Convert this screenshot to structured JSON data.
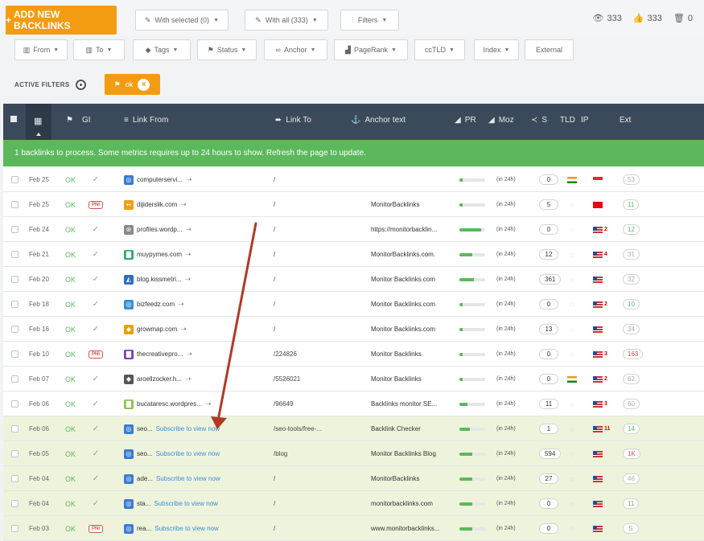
{
  "toolbar": {
    "add_label": "ADD NEW BACKLINKS",
    "with_selected": "With selected (0)",
    "with_all": "With all (333)",
    "filters": "Filters",
    "views": "333",
    "likes": "333",
    "trash": "0"
  },
  "filters": [
    "From",
    "To",
    "Tags",
    "Status",
    "Anchor",
    "PageRank",
    "ccTLD",
    "Index",
    "External"
  ],
  "active_filters": {
    "label": "ACTIVE FILTERS",
    "chip": "ok"
  },
  "columns": {
    "gi": "GI",
    "link_from": "Link From",
    "link_to": "Link To",
    "anchor_text": "Anchor text",
    "pr": "PR",
    "moz": "Moz",
    "s": "S",
    "tld": "TLD",
    "ip": "IP",
    "ext": "Ext"
  },
  "banner": "1 backlinks to process. Some metrics requires up to 24 hours to show. Refresh the page to update.",
  "rows": [
    {
      "date": "Feb 25",
      "status": "OK",
      "from": "computerservi...",
      "link_to": "/",
      "anchor": "",
      "pr": 0.12,
      "moz": "(in 24h)",
      "s": "0",
      "tld": "in",
      "ip_flag": "sg",
      "ip_n": "",
      "ext": "53",
      "ext_c": "grey"
    },
    {
      "date": "Feb 25",
      "status": "OK",
      "gi": "PNI",
      "from": "dijiderslik.com",
      "link_to": "/",
      "anchor": "MonitorBacklinks",
      "pr": 0.12,
      "moz": "(in 24h)",
      "s": "5",
      "tld": "globe",
      "ip_flag": "tr",
      "ip_n": "",
      "ext": "11",
      "ext_c": "green"
    },
    {
      "date": "Feb 24",
      "status": "OK",
      "from": "profiles.wordp...",
      "link_to": "/",
      "anchor": "https://monitorbacklin...",
      "pr": 0.85,
      "moz": "(in 24h)",
      "s": "0",
      "tld": "globe",
      "ip_flag": "us",
      "ip_n": "2",
      "ext": "12",
      "ext_c": "green"
    },
    {
      "date": "Feb 21",
      "status": "OK",
      "from": "muypymes.com",
      "link_to": "/",
      "anchor": "MonitorBacklinks.com.",
      "pr": 0.5,
      "moz": "(in 24h)",
      "s": "12",
      "tld": "globe",
      "ip_flag": "us",
      "ip_n": "4",
      "ext": "31",
      "ext_c": "grey"
    },
    {
      "date": "Feb 20",
      "status": "OK",
      "from": "blog.kissmetri...",
      "link_to": "/",
      "anchor": "Monitor Backlinks.com",
      "pr": 0.55,
      "moz": "(in 24h)",
      "s": "361",
      "tld": "globe",
      "ip_flag": "us",
      "ip_n": "",
      "ext": "32",
      "ext_c": "grey"
    },
    {
      "date": "Feb 18",
      "status": "OK",
      "from": "bizfeedz.com",
      "link_to": "/",
      "anchor": "Monitor Backlinks.com",
      "pr": 0.12,
      "moz": "(in 24h)",
      "s": "0",
      "tld": "globe",
      "ip_flag": "us",
      "ip_n": "2",
      "ext": "10",
      "ext_c": "green"
    },
    {
      "date": "Feb 16",
      "status": "OK",
      "from": "growmap.com",
      "link_to": "/",
      "anchor": "Monitor Backlinks.com",
      "pr": 0.12,
      "moz": "(in 24h)",
      "s": "13",
      "tld": "globe",
      "ip_flag": "us",
      "ip_n": "",
      "ext": "34",
      "ext_c": "grey"
    },
    {
      "date": "Feb 10",
      "status": "OK",
      "gi": "PNI",
      "from": "thecreativepro...",
      "link_to": "/224826",
      "anchor": "Monitor Backlinks",
      "pr": 0.12,
      "moz": "(in 24h)",
      "s": "0",
      "tld": "globe",
      "ip_flag": "us",
      "ip_n": "3",
      "ext": "163",
      "ext_c": "red"
    },
    {
      "date": "Feb 07",
      "status": "OK",
      "from": "aroellzocker.h...",
      "link_to": "/5526021",
      "anchor": "Monitor Backlinks",
      "pr": 0.12,
      "moz": "(in 24h)",
      "s": "0",
      "tld": "in",
      "ip_flag": "us",
      "ip_n": "2",
      "ext": "62",
      "ext_c": "grey"
    },
    {
      "date": "Feb 06",
      "status": "OK",
      "from": "bucataresc.wordpres...",
      "link_to": "/96649",
      "anchor": "Backlinks monitor SE...",
      "pr": 0.3,
      "moz": "(in 24h)",
      "s": "11",
      "tld": "globe",
      "ip_flag": "us",
      "ip_n": "3",
      "ext": "60",
      "ext_c": "grey"
    },
    {
      "date": "Feb 06",
      "status": "OK",
      "from": "seo...",
      "sub": "Subscribe to view now",
      "link_to": "/seo-tools/free-...",
      "anchor": "Backlink Checker",
      "pr": 0.4,
      "moz": "(in 24h)",
      "s": "1",
      "tld": "globe",
      "ip_flag": "us",
      "ip_n": "11",
      "ext": "14",
      "ext_c": "green",
      "hl": true
    },
    {
      "date": "Feb 05",
      "status": "OK",
      "from": "seo...",
      "sub": "Subscribe to view now",
      "link_to": "/blog",
      "anchor": "Monitor Backlinks Blog",
      "pr": 0.5,
      "moz": "(in 24h)",
      "s": "594",
      "tld": "globe",
      "ip_flag": "us",
      "ip_n": "",
      "ext": "1K",
      "ext_c": "red",
      "hl": true
    },
    {
      "date": "Feb 04",
      "status": "OK",
      "from": "ade...",
      "sub": "Subscribe to view now",
      "link_to": "/",
      "anchor": "MonitorBacklinks",
      "pr": 0.5,
      "moz": "(in 24h)",
      "s": "27",
      "tld": "globe",
      "ip_flag": "us",
      "ip_n": "",
      "ext": "46",
      "ext_c": "grey",
      "hl": true
    },
    {
      "date": "Feb 04",
      "status": "OK",
      "from": "sta...",
      "sub": "Subscribe to view now",
      "link_to": "/",
      "anchor": "monitorbacklinks.com",
      "pr": 0.5,
      "moz": "(in 24h)",
      "s": "0",
      "tld": "globe",
      "ip_flag": "us",
      "ip_n": "",
      "ext": "11",
      "ext_c": "green",
      "hl": true
    },
    {
      "date": "Feb 03",
      "status": "OK",
      "gi": "PNI",
      "from": "rea...",
      "sub": "Subscribe to view now",
      "link_to": "/",
      "anchor": "www.monitorbacklinks...",
      "pr": 0.5,
      "moz": "(in 24h)",
      "s": "0",
      "tld": "globe",
      "ip_flag": "us",
      "ip_n": "",
      "ext": "5",
      "ext_c": "green",
      "hl": true
    }
  ],
  "colors": {
    "accent": "#f39c12",
    "header": "#3b4a5a",
    "banner": "#5cb85c",
    "ok": "#5cb85c",
    "highlight": "#eef4dc",
    "arrow": "#b03a24"
  }
}
